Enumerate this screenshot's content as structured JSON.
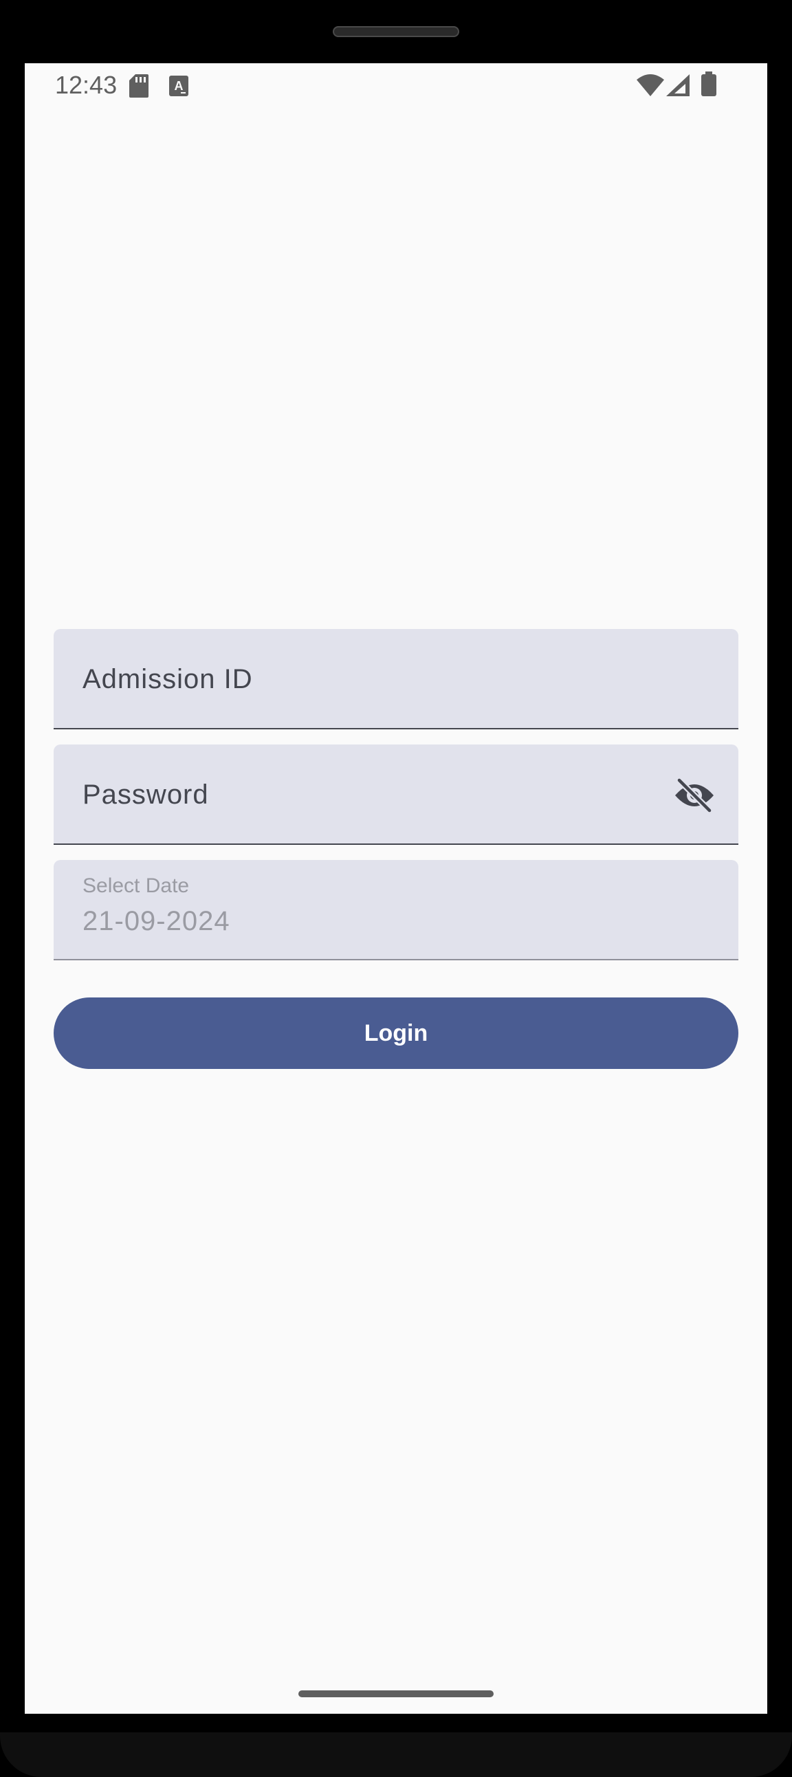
{
  "status_bar": {
    "time": "12:43",
    "left_icons": [
      "sd-card-icon",
      "text-a-icon"
    ],
    "right_icons": [
      "wifi-icon",
      "signal-icon",
      "battery-icon"
    ]
  },
  "form": {
    "admission_id": {
      "label": "Admission ID",
      "value": ""
    },
    "password": {
      "label": "Password",
      "value": "",
      "toggle_icon": "visibility-off-icon"
    },
    "date": {
      "label": "Select Date",
      "value": "21-09-2024"
    },
    "login_button": {
      "label": "Login"
    }
  },
  "colors": {
    "background": "#fafafa",
    "field_fill": "#e1e2ec",
    "field_text": "#44464f",
    "disabled_text": "#9a9ba3",
    "primary": "#4a5c92",
    "on_primary": "#ffffff"
  }
}
